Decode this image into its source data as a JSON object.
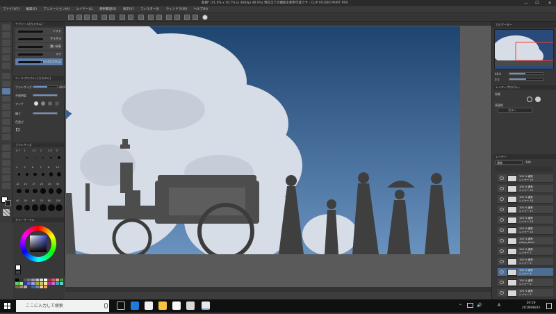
{
  "window": {
    "title": "無題* (41.0% x 16.7% in 300dpi 48.0%) 現在全ての機能を使用可能です - CLIP STUDIO PAINT PRO",
    "min": "—",
    "max": "☐",
    "close": "✕"
  },
  "menu": [
    "ファイル(F)",
    "編集(E)",
    "アニメーション(A)",
    "レイヤー(L)",
    "選択範囲(S)",
    "表示(V)",
    "フィルター(I)",
    "ウィンドウ(W)",
    "ヘルプ(H)"
  ],
  "subtool": {
    "tab": "サブツール[カスタム]",
    "brushes": [
      {
        "label": "ソフト"
      },
      {
        "label": "ザラザラ"
      },
      {
        "label": "濃い水彩"
      },
      {
        "label": "ラフ"
      },
      {
        "label": "ブラシ(カスタム)"
      }
    ]
  },
  "tooldetail": {
    "tab": "ツールプロパティ[カスタム]",
    "rows": [
      {
        "label": "ブラシサイズ",
        "value": "40.0"
      },
      {
        "label": "不透明度",
        "value": "100"
      },
      {
        "label": "アンチ",
        "value": ""
      },
      {
        "label": "硬さ",
        "value": "100"
      },
      {
        "label": "色混ぜ",
        "value": ""
      }
    ]
  },
  "brushsize": {
    "tab": "ブラシサイズ",
    "sizes": [
      "0.7",
      "1",
      "1.5",
      "2",
      "2.5",
      "3",
      "4",
      "5",
      "6",
      "7",
      "8",
      "10",
      "12",
      "15",
      "17",
      "20",
      "25",
      "30",
      "40",
      "50",
      "60",
      "70",
      "80",
      "100"
    ]
  },
  "colorwheel": {
    "tab": "カラーサークル"
  },
  "navigator": {
    "tab": "ナビゲーター",
    "zoom": "48.0",
    "angle": "0.0"
  },
  "layerprop": {
    "tab": "レイヤープロパティ",
    "effect_label": "効果",
    "expression_label": "表現色",
    "expression_value": "カラー"
  },
  "layers": {
    "tab": "レイヤー",
    "blend": "通常",
    "opacity": "100",
    "rows": [
      {
        "l1": "100 % 通常",
        "l2": "レイヤー 20"
      },
      {
        "l1": "100 % 通常",
        "l2": "レイヤー 19"
      },
      {
        "l1": "100 % 通常",
        "l2": "レイヤー 18"
      },
      {
        "l1": "100 % 通常",
        "l2": "レイヤー 17"
      },
      {
        "l1": "100 % 通常",
        "l2": "レイヤー 16"
      },
      {
        "l1": "100 % 通常",
        "l2": "レイヤー 15"
      },
      {
        "l1": "100 % 通常",
        "l2": "celsys_twod"
      },
      {
        "l1": "100 % 通常",
        "l2": "レイヤー 7"
      },
      {
        "l1": "100 % 通常",
        "l2": "レイヤー 5"
      },
      {
        "l1": "100 % 通常",
        "l2": "レイヤー 4"
      },
      {
        "l1": "100 % 通常",
        "l2": "レイヤー 2"
      },
      {
        "l1": "100 % 通常",
        "l2": "レイヤー 1"
      }
    ],
    "selected_index": 9
  },
  "taskbar": {
    "search_placeholder": "ここに入力して検索",
    "time": "20:19",
    "date": "2019/08/03",
    "ime": "A"
  },
  "colors": {
    "sky_top": "#1e4470",
    "sky_bottom": "#6a92bf",
    "accent": "#5d7ea8"
  }
}
